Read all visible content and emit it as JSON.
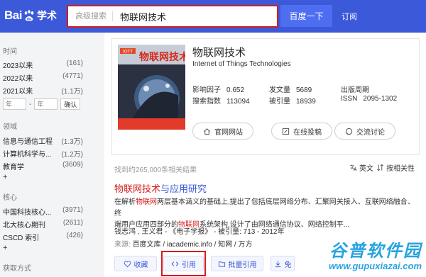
{
  "header": {
    "logo_text_left": "Bai",
    "logo_text_right": "学术",
    "search_type": "高级搜索",
    "search_value": "物联网技术",
    "search_button": "百度一下",
    "subscribe": "订阅",
    "bg_color": "#3b59d9",
    "highlight_color": "#d61b1b"
  },
  "sidebar": {
    "time": {
      "title": "时间",
      "items": [
        {
          "label": "2023以来",
          "count": "(161)"
        },
        {
          "label": "2022以来",
          "count": "(4771)"
        },
        {
          "label": "2021以来",
          "count": "(1.1万)"
        }
      ],
      "from_placeholder": "年",
      "to_placeholder": "年",
      "dash": "-",
      "confirm": "确认"
    },
    "field": {
      "title": "领域",
      "items": [
        {
          "label": "信息与通信工程",
          "count": "(1.3万)"
        },
        {
          "label": "计算机科学与...",
          "count": "(1.2万)"
        },
        {
          "label": "教育学",
          "count": "(3609)"
        }
      ],
      "more": "+"
    },
    "core": {
      "title": "核心",
      "items": [
        {
          "label": "中国科技核心...",
          "count": "(3971)"
        },
        {
          "label": "北大核心期刊",
          "count": "(2611)"
        },
        {
          "label": "CSCD 索引",
          "count": "(426)"
        }
      ],
      "more": "+"
    },
    "access": {
      "title": "获取方式"
    }
  },
  "journal": {
    "title": "物联网技术",
    "subtitle": "Internet of Things Technologies",
    "cover_title": "物联网技术",
    "cover_tag": "IOTT",
    "stats": [
      {
        "label": "影响因子",
        "value": "0.652"
      },
      {
        "label": "发文量",
        "value": "5689"
      },
      {
        "label": "出版周期",
        "value": ""
      },
      {
        "label": "搜索指数",
        "value": "113094"
      },
      {
        "label": "被引量",
        "value": "18939"
      },
      {
        "label": "ISSN",
        "value": "2095-1302"
      }
    ],
    "buttons": {
      "site": "官网网站",
      "submit": "在线投稿",
      "discuss": "交流讨论"
    }
  },
  "results": {
    "found": "找到约265,000条相关结果",
    "lang": "英文",
    "sort": "按相关性",
    "item": {
      "title_hl": "物联网技术",
      "title_rest": "与应用研究",
      "abstract": {
        "p1": "在解析",
        "h1": "物联网",
        "p2": "两层基本涵义的基础上,提出了包括底层网络分布、汇聚网关接入、互联网络融合、终",
        "p3": "端用户应用四部分的",
        "h2": "物联网",
        "p4": "系统架构,设计了由网络通信协议、网络控制平..."
      },
      "authors": "钱志鸿 , 王义君 - 《电子学报》 - 被引量: 713 - 2012年",
      "source_label": "来源:",
      "sources": "百度文库 / iacademic.info / 知网 / 万方",
      "actions": {
        "collect": "收藏",
        "cite": "引用",
        "batch_cite": "批量引用",
        "free": "免"
      }
    }
  },
  "watermark": {
    "brand": "谷普软件园",
    "url": "www.gupuxiazai.com"
  }
}
